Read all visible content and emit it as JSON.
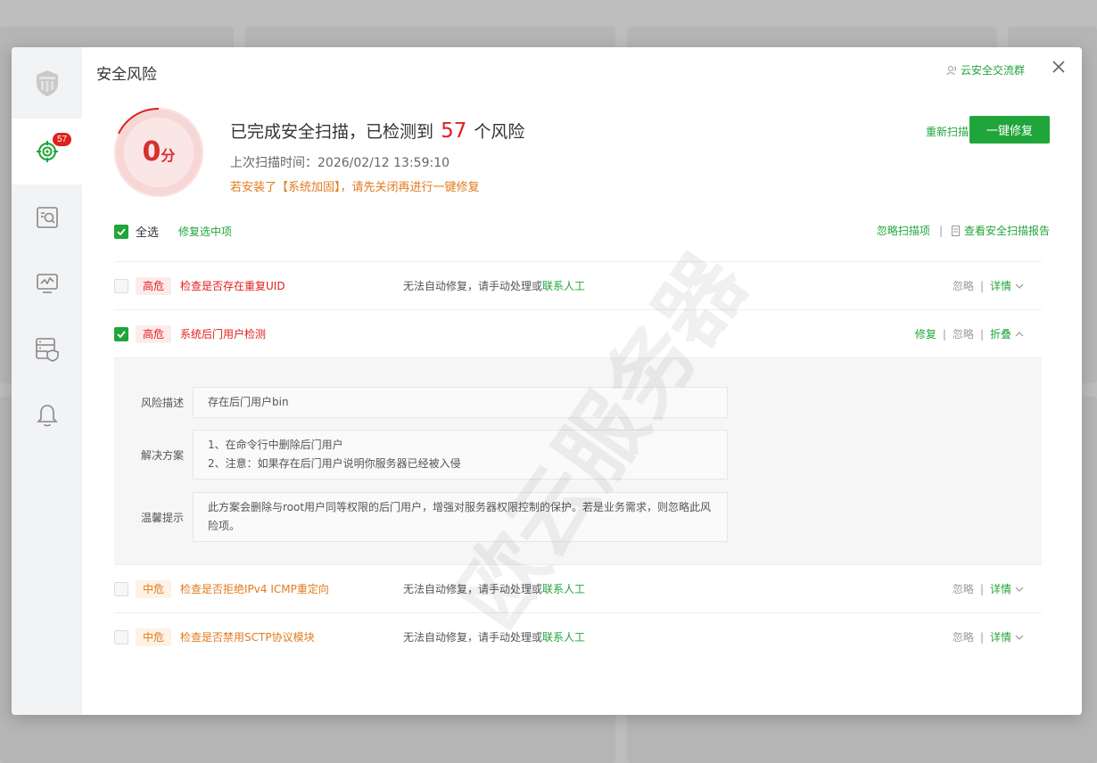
{
  "modal": {
    "title": "安全风险",
    "group_link": "云安全交流群"
  },
  "sidebar": {
    "badge": "57",
    "items": [
      "shield-logo",
      "scan",
      "file-search",
      "monitor",
      "server-shield",
      "bell"
    ]
  },
  "summary": {
    "score": "0",
    "score_unit": "分",
    "title_prefix": "已完成安全扫描，已检测到",
    "risk_count": "57",
    "title_suffix": "个风险",
    "last_scan_label": "上次扫描时间：",
    "last_scan_time": "2026/02/12 13:59:10",
    "warning": "若安装了【系统加固】，请先关闭再进行一键修复",
    "rescan": "重新扫描",
    "fix_all": "一键修复"
  },
  "toolbar": {
    "select_all": "全选",
    "fix_selected": "修复选中项",
    "ignore_items": "忽略扫描项",
    "view_report": "查看安全扫描报告"
  },
  "labels": {
    "fix": "修复",
    "ignore": "忽略",
    "details": "详情",
    "collapse": "折叠",
    "no_auto_fix": "无法自动修复，请手动处理或",
    "contact": "联系人工"
  },
  "risks": [
    {
      "level": "高危",
      "name": "检查是否存在重复UID",
      "checked": false
    },
    {
      "level": "高危",
      "name": "系统后门用户检测",
      "checked": true
    },
    {
      "level": "中危",
      "name": "检查是否拒绝IPv4 ICMP重定向",
      "checked": false
    },
    {
      "level": "中危",
      "name": "检查是否禁用SCTP协议模块",
      "checked": false
    }
  ],
  "detail": {
    "desc_label": "风险描述",
    "desc": "存在后门用户bin",
    "solution_label": "解决方案",
    "solution_1": "1、在命令行中删除后门用户",
    "solution_2": "2、注意：如果存在后门用户说明你服务器已经被入侵",
    "tip_label": "温馨提示",
    "tip": "此方案会删除与root用户同等权限的后门用户，增强对服务器权限控制的保护。若是业务需求，则忽略此风险项。"
  },
  "watermark": "欧云服务器",
  "colors": {
    "accent": "#20a53a",
    "high": "#e0201d",
    "mid": "#e27a1e"
  }
}
